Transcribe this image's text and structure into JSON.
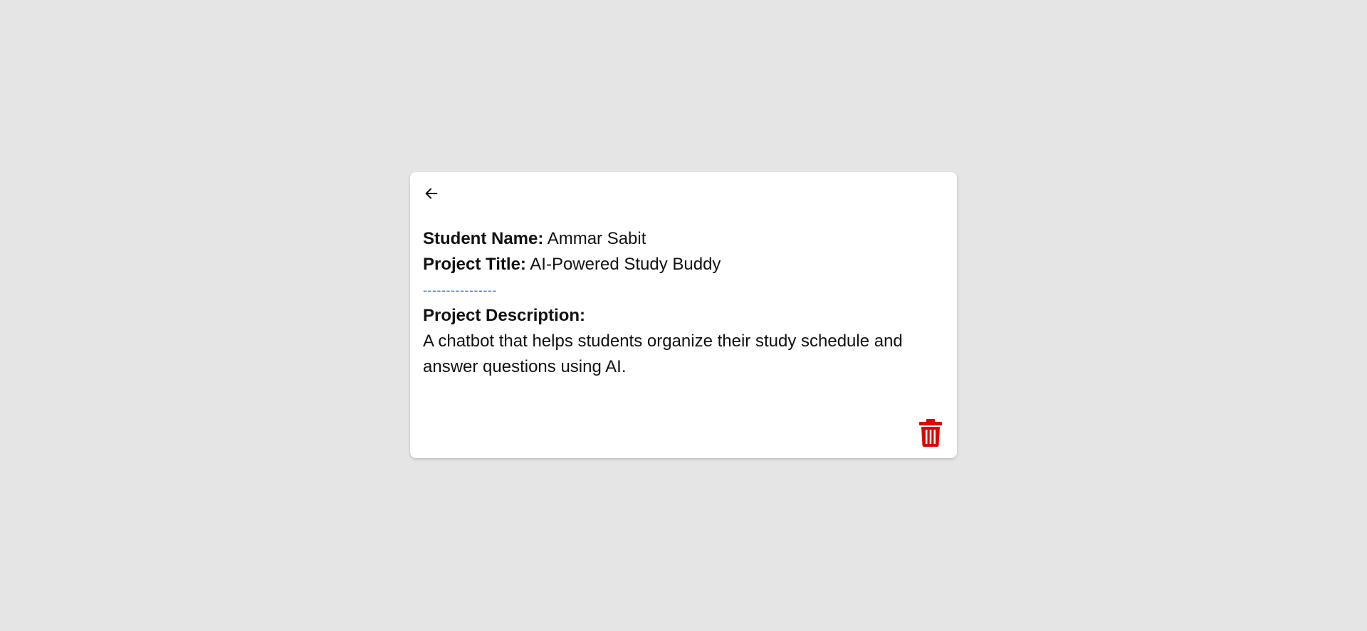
{
  "card": {
    "back_icon": "arrow-left-icon",
    "student_name_label": "Student Name:",
    "student_name_value": "Ammar Sabit",
    "project_title_label": "Project Title:",
    "project_title_value": "AI-Powered Study Buddy",
    "divider": "----------------",
    "project_description_label": "Project Description:",
    "project_description_value": "A chatbot that helps students organize their study schedule and answer questions using AI.",
    "delete_icon": "trash-icon"
  },
  "colors": {
    "background": "#e5e5e5",
    "card": "#ffffff",
    "divider": "#3b82f6",
    "delete": "#e00000"
  }
}
